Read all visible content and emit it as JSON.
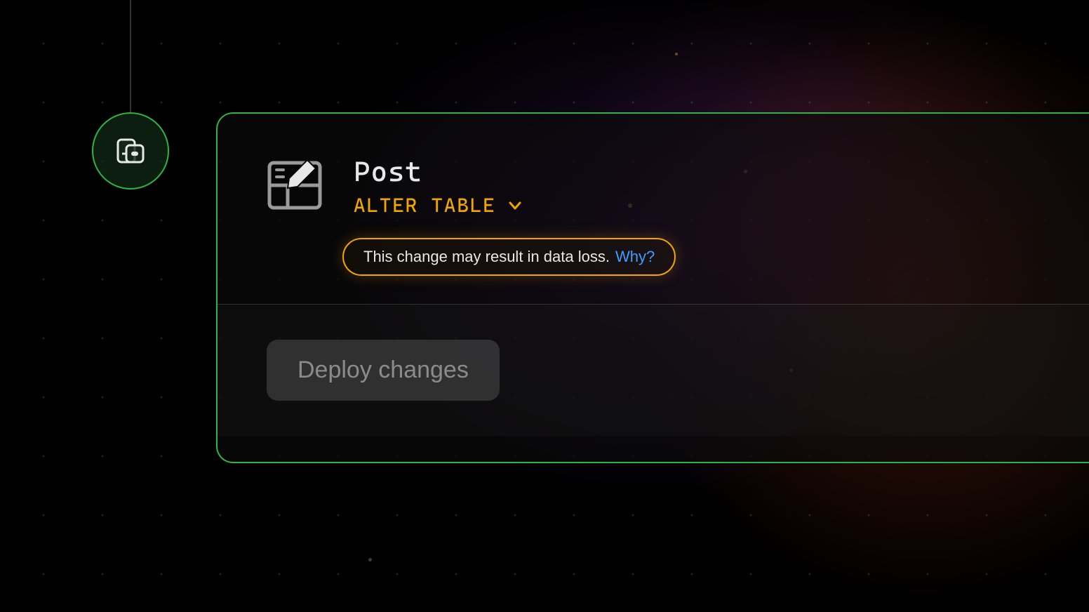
{
  "card": {
    "table_name": "Post",
    "operation": "ALTER TABLE",
    "warning": {
      "text": "This change may result in data loss.",
      "link_text": "Why?"
    },
    "deploy_button": "Deploy changes"
  },
  "colors": {
    "accent_green": "#2fb344",
    "accent_amber": "#f0a500",
    "link_blue": "#3b9eff"
  }
}
